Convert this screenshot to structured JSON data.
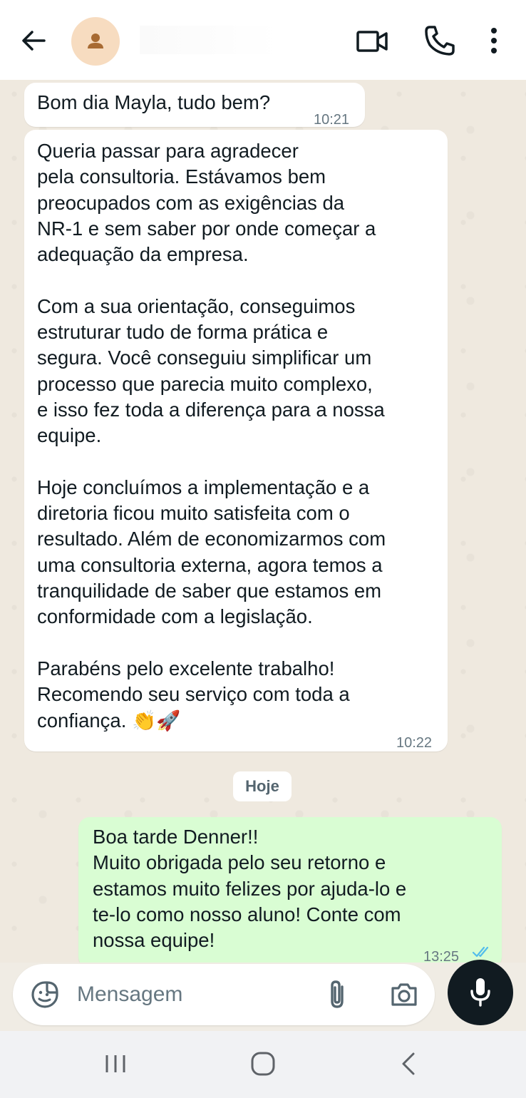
{
  "header": {
    "contact_name": "",
    "icons": {
      "back": "arrow-left-icon",
      "avatar": "person-icon",
      "video": "video-camera-icon",
      "call": "phone-icon",
      "more": "more-vertical-icon"
    }
  },
  "messages": [
    {
      "direction": "incoming",
      "text": "Bom dia Mayla, tudo bem?",
      "time": "10:21"
    },
    {
      "direction": "incoming",
      "text": "Queria passar para agradecer\npela consultoria. Estávamos bem\npreocupados com as exigências da\nNR-1 e sem saber por onde começar a\nadequação da empresa.\n\nCom a sua orientação, conseguimos\nestruturar tudo de forma prática e\nsegura. Você conseguiu simplificar um\nprocesso que parecia muito complexo,\ne isso fez toda a diferença para a nossa\nequipe.\n\nHoje concluímos a implementação e a\ndiretoria ficou muito satisfeita com o\nresultado. Além de economizarmos com\numa consultoria externa, agora temos a\ntranquilidade de saber que estamos em\nconformidade com a legislação.\n\nParabéns pelo excelente trabalho!\nRecomendo seu serviço com toda a\nconfiança. 👏🚀",
      "time": "10:22"
    },
    {
      "direction": "outgoing",
      "text": "Boa tarde Denner!!\nMuito obrigada pelo seu retorno e\nestamos muito felizes por ajuda-lo e\nte-lo como nosso aluno! Conte com\nnossa equipe!",
      "time": "13:25",
      "status": "read"
    }
  ],
  "date_separator": "Hoje",
  "input": {
    "placeholder": "Mensagem",
    "value": ""
  },
  "colors": {
    "incoming_bubble": "#ffffff",
    "outgoing_bubble": "#d9fdd3",
    "read_ticks": "#53bdeb",
    "mic_button": "#111b21"
  }
}
